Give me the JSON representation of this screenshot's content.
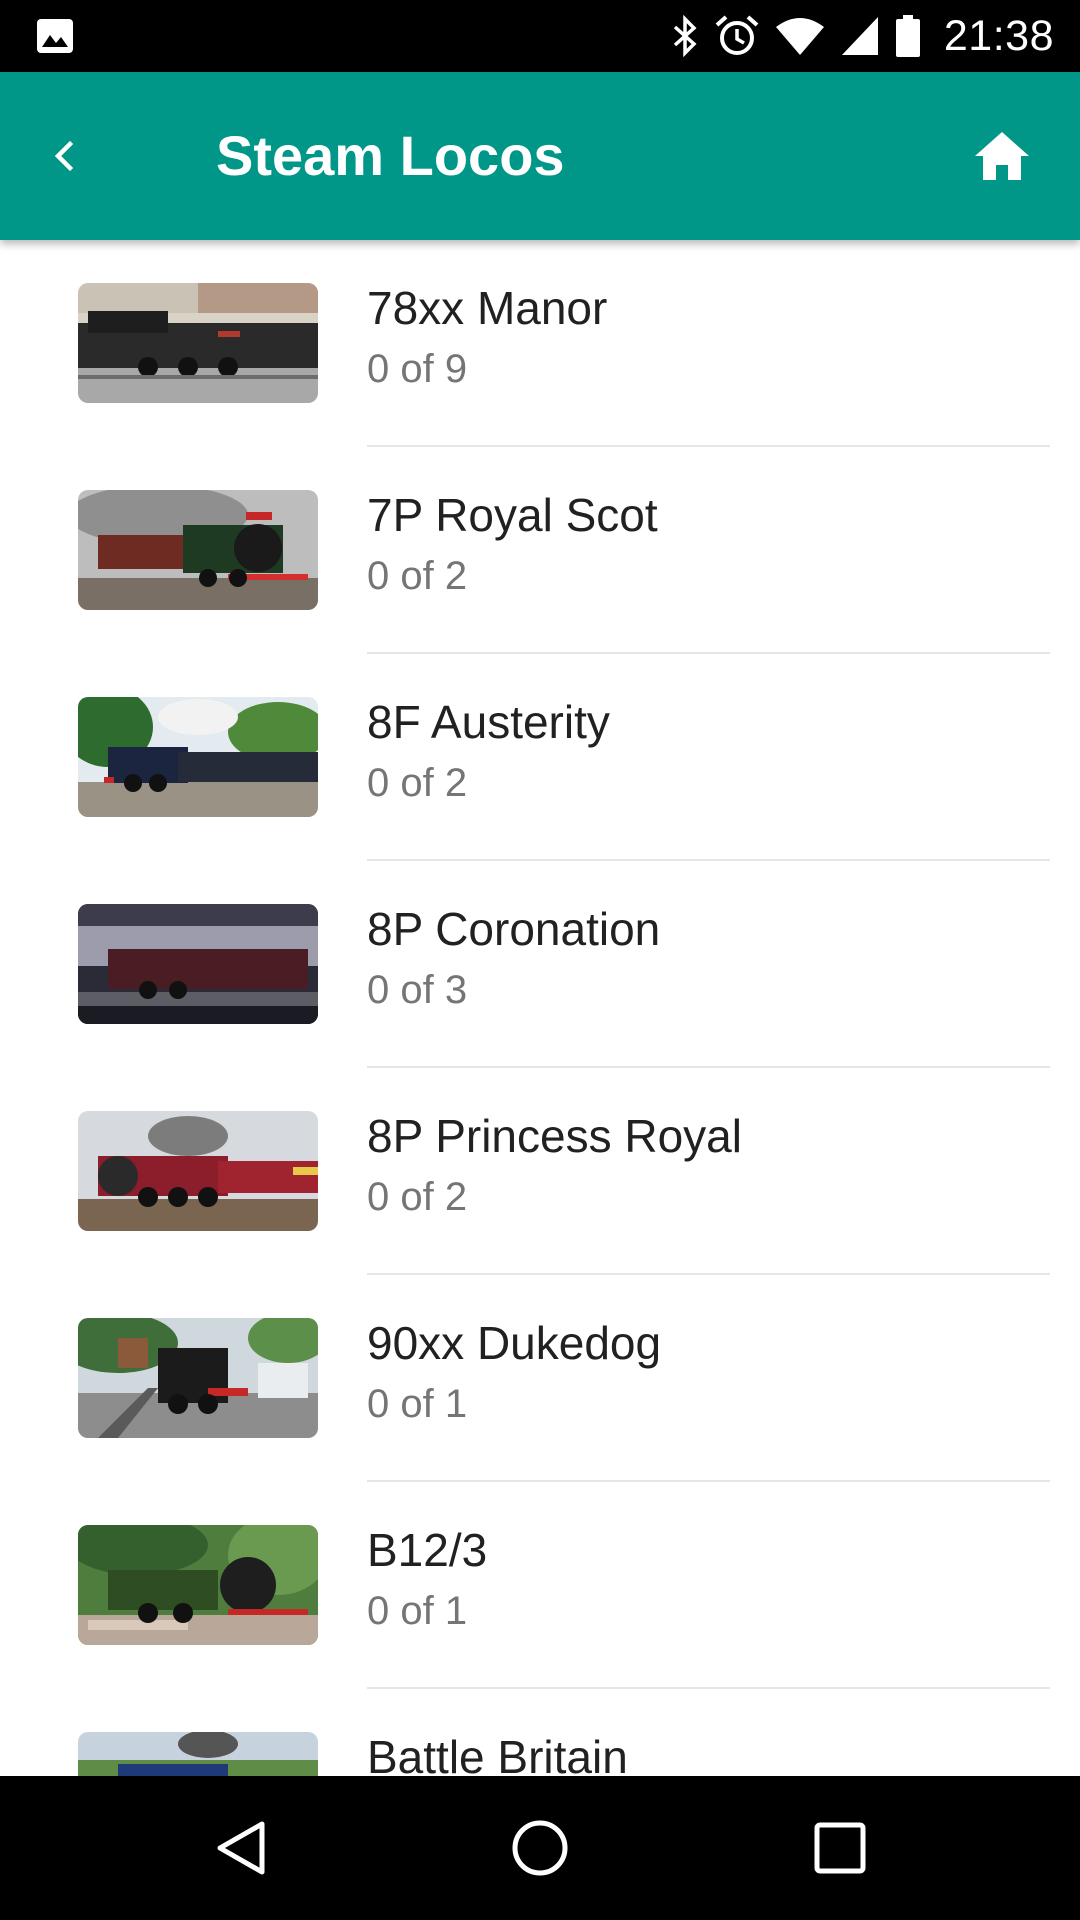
{
  "status_bar": {
    "time": "21:38",
    "icons": [
      "image-notification-icon",
      "bluetooth-icon",
      "alarm-icon",
      "wifi-icon",
      "cellular-signal-icon",
      "battery-icon"
    ]
  },
  "app_bar": {
    "title": "Steam Locos",
    "back_icon": "chevron-left-icon",
    "home_icon": "home-icon",
    "color": "#009688"
  },
  "locos": [
    {
      "name": "78xx Manor",
      "count": "0 of 9"
    },
    {
      "name": "7P Royal Scot",
      "count": "0 of 2"
    },
    {
      "name": "8F Austerity",
      "count": "0 of 2"
    },
    {
      "name": "8P Coronation",
      "count": "0 of 3"
    },
    {
      "name": "8P Princess Royal",
      "count": "0 of 2"
    },
    {
      "name": "90xx Dukedog",
      "count": "0 of 1"
    },
    {
      "name": "B12/3",
      "count": "0 of 1"
    },
    {
      "name": "Battle Britain",
      "count": ""
    }
  ],
  "nav_bar": {
    "buttons": [
      "back-triangle-icon",
      "home-circle-icon",
      "recents-square-icon"
    ]
  }
}
